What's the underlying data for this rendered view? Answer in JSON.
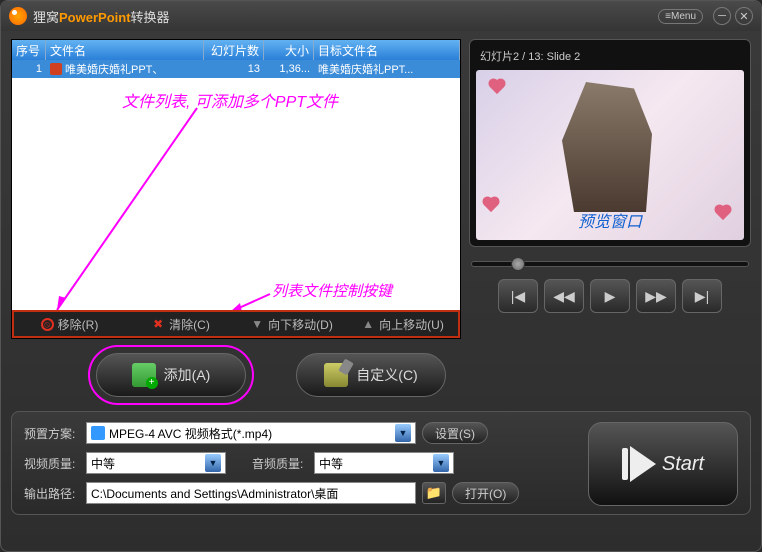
{
  "title_prefix": "狸窝",
  "title_accent": "PowerPoint",
  "title_suffix": "转换器",
  "menu_label": "Menu",
  "table": {
    "headers": {
      "seq": "序号",
      "filename": "文件名",
      "slides": "幻灯片数",
      "size": "大小",
      "target": "目标文件名"
    },
    "row": {
      "seq": "1",
      "filename": "唯美婚庆婚礼PPT、",
      "slides": "13",
      "size": "1,36...",
      "target": "唯美婚庆婚礼PPT..."
    },
    "anno_filelist": "文件列表, 可添加多个PPT文件",
    "anno_ctrl": "列表文件控制按键"
  },
  "listctrl": {
    "remove": "移除(R)",
    "clear": "清除(C)",
    "down": "向下移动(D)",
    "up": "向上移动(U)"
  },
  "preview": {
    "counter": "幻灯片2 / 13: Slide 2",
    "label": "预览窗口"
  },
  "buttons": {
    "add": "添加(A)",
    "custom": "自定义(C)"
  },
  "settings": {
    "preset_label": "预置方案:",
    "preset_value": "MPEG-4 AVC 视频格式(*.mp4)",
    "settings_btn": "设置(S)",
    "vq_label": "视频质量:",
    "vq_value": "中等",
    "aq_label": "音频质量:",
    "aq_value": "中等",
    "out_label": "输出路径:",
    "out_value": "C:\\Documents and Settings\\Administrator\\桌面",
    "open_btn": "打开(O)"
  },
  "start": "Start"
}
